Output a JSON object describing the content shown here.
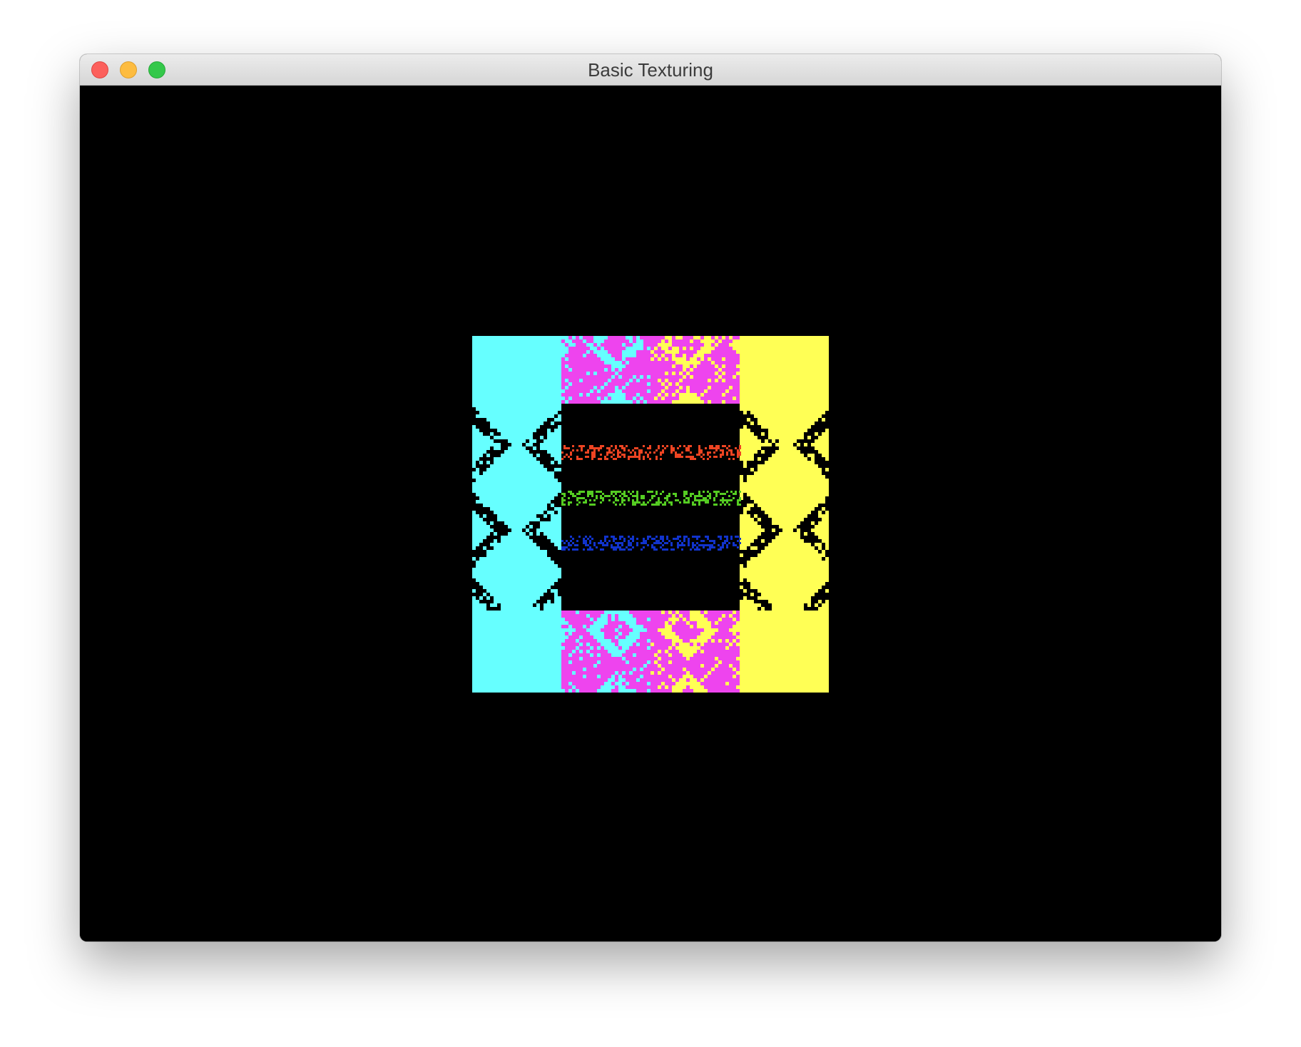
{
  "window": {
    "title": "Basic Texturing"
  },
  "scene": {
    "background_color": "#000000",
    "texture_colors": {
      "cyan": "#66ffff",
      "magenta": "#ee44ee",
      "yellow": "#ffff55",
      "black": "#000000",
      "red": "#ee4422",
      "green": "#55cc22",
      "blue": "#1133cc"
    }
  },
  "icons": {
    "close": "close-button-icon",
    "minimize": "minimize-button-icon",
    "maximize": "maximize-button-icon"
  }
}
